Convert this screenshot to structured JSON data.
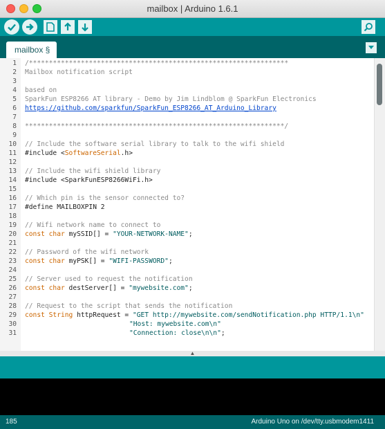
{
  "window": {
    "title": "mailbox | Arduino 1.6.1"
  },
  "toolbar": {
    "buttons": [
      "verify",
      "upload",
      "new",
      "open",
      "save",
      "serial-monitor"
    ]
  },
  "tabs": [
    {
      "label": "mailbox §"
    }
  ],
  "editor": {
    "lines": [
      {
        "n": "1",
        "text": "/*****************************************************************",
        "type": "comment"
      },
      {
        "n": "2",
        "text": "Mailbox notification script",
        "type": "comment"
      },
      {
        "n": "3",
        "text": "",
        "type": "comment"
      },
      {
        "n": "4",
        "text": "based on",
        "type": "comment"
      },
      {
        "n": "5",
        "text": "SparkFun ESP8266 AT library - Demo by Jim Lindblom @ SparkFun Electronics",
        "type": "comment"
      },
      {
        "n": "6",
        "text": "https://github.com/sparkfun/SparkFun_ESP8266_AT_Arduino_Library",
        "type": "link"
      },
      {
        "n": "7",
        "text": "",
        "type": "comment"
      },
      {
        "n": "8",
        "text": "*****************************************************************/",
        "type": "comment"
      },
      {
        "n": "9",
        "text": "",
        "type": "plain"
      },
      {
        "n": "10",
        "text": "// Include the software serial library to talk to the wifi shield",
        "type": "comment"
      },
      {
        "n": "11",
        "text": "#include <SoftwareSerial.h>",
        "type": "include-cls",
        "pre": "#include <",
        "cls": "SoftwareSerial",
        "post": ".h>"
      },
      {
        "n": "12",
        "text": "",
        "type": "plain"
      },
      {
        "n": "13",
        "text": "// Include the wifi shield library",
        "type": "comment"
      },
      {
        "n": "14",
        "text": "#include <SparkFunESP8266WiFi.h>",
        "type": "plain"
      },
      {
        "n": "15",
        "text": "",
        "type": "plain"
      },
      {
        "n": "16",
        "text": "// Which pin is the sensor connected to?",
        "type": "comment"
      },
      {
        "n": "17",
        "text": "#define MAILBOXPIN 2",
        "type": "plain"
      },
      {
        "n": "18",
        "text": "",
        "type": "plain"
      },
      {
        "n": "19",
        "text": "// Wifi network name to connect to",
        "type": "comment"
      },
      {
        "n": "20",
        "type": "decl",
        "kw": "const char",
        "mid": " mySSID[] = ",
        "str": "\"YOUR-NETWORK-NAME\"",
        "end": ";"
      },
      {
        "n": "21",
        "text": "",
        "type": "plain"
      },
      {
        "n": "22",
        "text": "// Password of the wifi network",
        "type": "comment"
      },
      {
        "n": "23",
        "type": "decl",
        "kw": "const char",
        "mid": " myPSK[] = ",
        "str": "\"WIFI-PASSWORD\"",
        "end": ";"
      },
      {
        "n": "24",
        "text": "",
        "type": "plain"
      },
      {
        "n": "25",
        "text": "// Server used to request the notification",
        "type": "comment"
      },
      {
        "n": "26",
        "type": "decl",
        "kw": "const char",
        "mid": " destServer[] = ",
        "str": "\"mywebsite.com\"",
        "end": ";"
      },
      {
        "n": "27",
        "text": "",
        "type": "plain"
      },
      {
        "n": "28",
        "text": "// Request to the script that sends the notification",
        "type": "comment"
      },
      {
        "n": "29",
        "type": "decl",
        "kw": "const String",
        "mid": " httpRequest = ",
        "str": "\"GET http://mywebsite.com/sendNotification.php HTTP/1.1\\n\"",
        "end": ""
      },
      {
        "n": "30",
        "type": "cont",
        "str": "\"Host: mywebsite.com\\n\"",
        "end": ""
      },
      {
        "n": "31",
        "type": "cont",
        "str": "\"Connection: close\\n\\n\"",
        "end": ";"
      }
    ]
  },
  "status": {
    "line_number": "185",
    "board": "Arduino Uno on /dev/tty.usbmodem1411"
  }
}
